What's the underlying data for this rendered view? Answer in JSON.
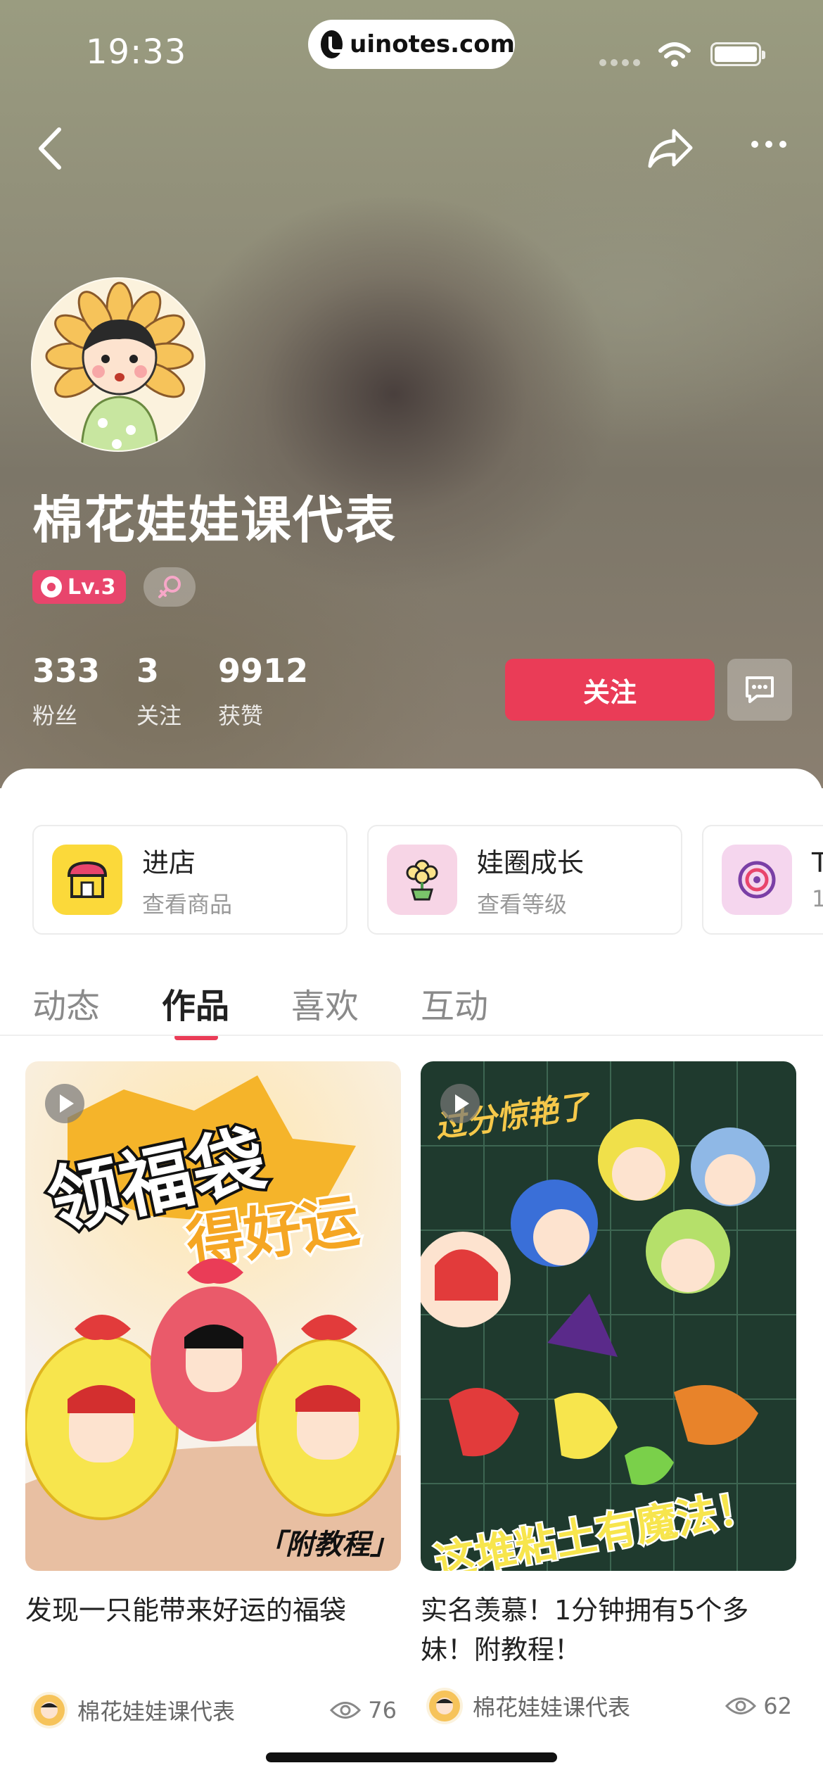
{
  "status_bar": {
    "time": "19:33",
    "url": "uinotes.com"
  },
  "profile": {
    "name": "棉花娃娃课代表",
    "level": "Lv.3",
    "stats": [
      {
        "value": "333",
        "label": "粉丝"
      },
      {
        "value": "3",
        "label": "关注"
      },
      {
        "value": "9912",
        "label": "获赞"
      }
    ],
    "follow_label": "关注"
  },
  "cards": [
    {
      "title": "进店",
      "subtitle": "查看商品",
      "icon": "shop-icon"
    },
    {
      "title": "娃圈成长",
      "subtitle": "查看等级",
      "icon": "flower-pot-icon"
    },
    {
      "title": "T",
      "subtitle": "1",
      "icon": "spiral-icon"
    }
  ],
  "tabs": [
    "动态",
    "作品",
    "喜欢",
    "互动"
  ],
  "active_tab": "作品",
  "posts": [
    {
      "title": "发现一只能带来好运的福袋",
      "author": "棉花娃娃课代表",
      "views": "76",
      "overlay_top": "领福袋",
      "overlay_mid": "得好运",
      "overlay_bottom": "「附教程」"
    },
    {
      "title": "实名羡慕！1分钟拥有5个多妹！附教程！",
      "author": "棉花娃娃课代表",
      "views": "62",
      "overlay_top": "过分惊艳了",
      "overlay_bottom": "这堆粘土有魔法！"
    }
  ],
  "colors": {
    "accent": "#ea3c57",
    "badge": "#e8456c"
  }
}
